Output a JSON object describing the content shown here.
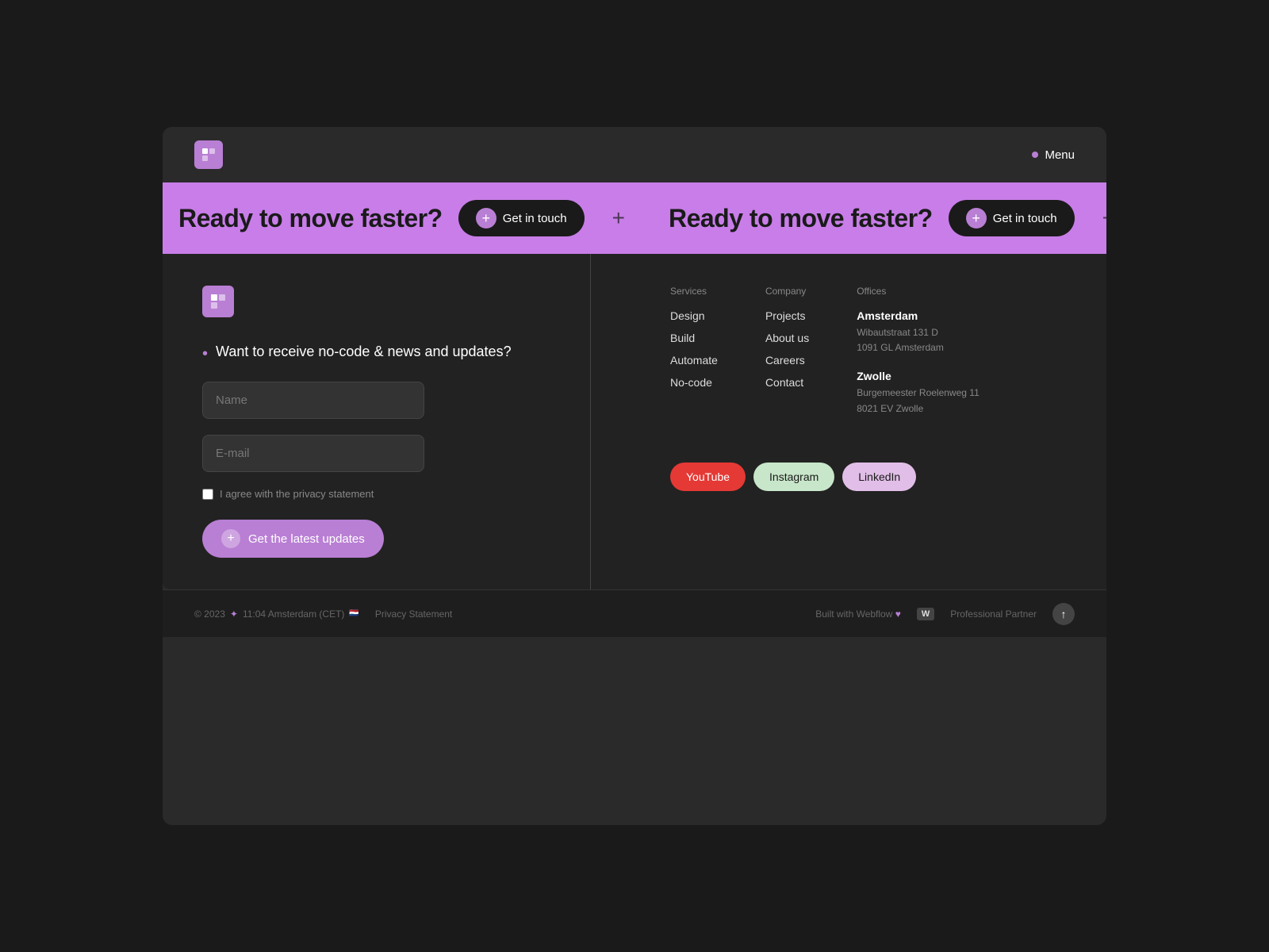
{
  "nav": {
    "logo_char": "▶",
    "menu_label": "Menu"
  },
  "ticker": {
    "text": "Ready to move faster?",
    "button_label": "Get in touch",
    "plus": "+",
    "separator": "+"
  },
  "footer": {
    "logo_char": "▶",
    "newsletter": {
      "bullet": "•",
      "title": "Want to receive no-code & news and updates?",
      "name_placeholder": "Name",
      "email_placeholder": "E-mail",
      "privacy_label": "I agree with the privacy statement",
      "submit_label": "Get the latest updates"
    },
    "services": {
      "heading": "Services",
      "items": [
        "Design",
        "Build",
        "Automate",
        "No-code"
      ]
    },
    "company": {
      "heading": "Company",
      "items": [
        "Projects",
        "About us",
        "Careers",
        "Contact"
      ]
    },
    "offices": {
      "heading": "Offices",
      "amsterdam": {
        "name": "Amsterdam",
        "line1": "Wibautstraat 131 D",
        "line2": "1091 GL Amsterdam"
      },
      "zwolle": {
        "name": "Zwolle",
        "line1": "Burgemeester Roelenweg 11",
        "line2": "8021 EV Zwolle"
      }
    },
    "social": {
      "youtube": "YouTube",
      "instagram": "Instagram",
      "linkedin": "LinkedIn"
    }
  },
  "bottom_bar": {
    "copyright": "© 2023",
    "dot": "✦",
    "time": "11:04 Amsterdam (CET)",
    "privacy": "Privacy Statement",
    "built_with": "Built with Webflow",
    "heart": "♥",
    "w_icon": "W",
    "partner": "Professional Partner"
  }
}
